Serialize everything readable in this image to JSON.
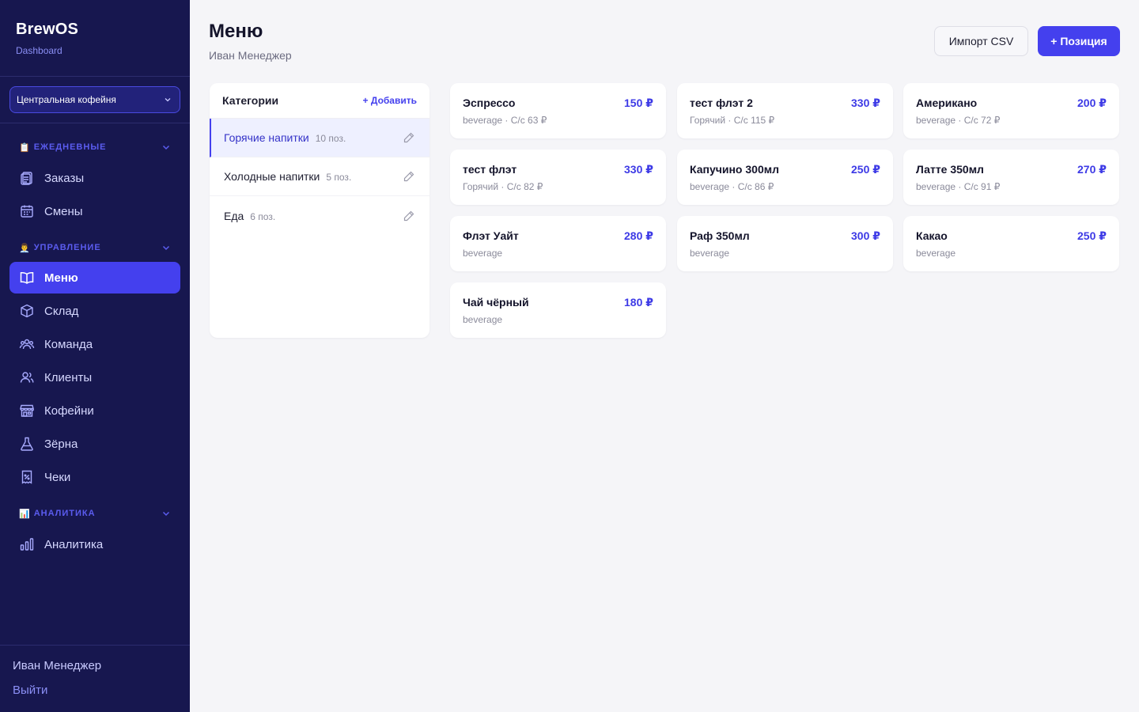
{
  "brand": {
    "name": "BrewOS",
    "sub": "Dashboard"
  },
  "shop_select": {
    "value": "Центральная кофейня"
  },
  "sections": {
    "daily": {
      "emoji": "📋",
      "title": "ЕЖЕДНЕВНЫЕ"
    },
    "manage": {
      "emoji": "👨‍💼",
      "title": "УПРАВЛЕНИЕ"
    },
    "analytics": {
      "emoji": "📊",
      "title": "АНАЛИТИКА"
    }
  },
  "nav": {
    "orders": "Заказы",
    "shifts": "Смены",
    "menu": "Меню",
    "warehouse": "Склад",
    "team": "Команда",
    "clients": "Клиенты",
    "cafes": "Кофейни",
    "beans": "Зёрна",
    "receipts": "Чеки",
    "analytics": "Аналитика"
  },
  "footer": {
    "user": "Иван Менеджер",
    "logout": "Выйти"
  },
  "header": {
    "title": "Меню",
    "subtitle": "Иван Менеджер",
    "import_label": "Импорт CSV",
    "add_label": "+ Позиция"
  },
  "categories": {
    "title": "Категории",
    "add_label": "+ Добавить",
    "items": [
      {
        "name": "Горячие напитки",
        "count": "10 поз."
      },
      {
        "name": "Холодные напитки",
        "count": "5 поз."
      },
      {
        "name": "Еда",
        "count": "6 поз."
      }
    ]
  },
  "products": [
    {
      "name": "Эспрессо",
      "price": "150 ₽",
      "meta": "beverage · С/с 63 ₽"
    },
    {
      "name": "тест флэт 2",
      "price": "330 ₽",
      "meta": "Горячий · С/с 115 ₽"
    },
    {
      "name": "Американо",
      "price": "200 ₽",
      "meta": "beverage · С/с 72 ₽"
    },
    {
      "name": "тест флэт",
      "price": "330 ₽",
      "meta": "Горячий · С/с 82 ₽"
    },
    {
      "name": "Капучино 300мл",
      "price": "250 ₽",
      "meta": "beverage · С/с 86 ₽"
    },
    {
      "name": "Латте 350мл",
      "price": "270 ₽",
      "meta": "beverage · С/с 91 ₽"
    },
    {
      "name": "Флэт Уайт",
      "price": "280 ₽",
      "meta": "beverage"
    },
    {
      "name": "Раф 350мл",
      "price": "300 ₽",
      "meta": "beverage"
    },
    {
      "name": "Какао",
      "price": "250 ₽",
      "meta": "beverage"
    },
    {
      "name": "Чай чёрный",
      "price": "180 ₽",
      "meta": "beverage"
    }
  ],
  "colors": {
    "sidebar": "#17174f",
    "accent": "#4440ee",
    "background": "#f5f5f8"
  }
}
